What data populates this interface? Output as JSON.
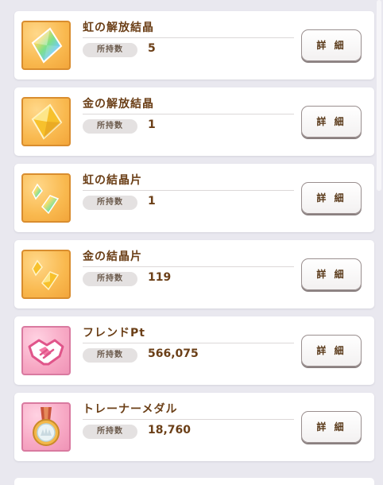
{
  "items": [
    {
      "name": "虹の解放結晶",
      "count_label": "所持数",
      "count": "5",
      "detail_label": "詳 細",
      "icon": "rainbow-crystal-icon",
      "theme": "gold"
    },
    {
      "name": "金の解放結晶",
      "count_label": "所持数",
      "count": "1",
      "detail_label": "詳 細",
      "icon": "gold-crystal-icon",
      "theme": "gold"
    },
    {
      "name": "虹の結晶片",
      "count_label": "所持数",
      "count": "1",
      "detail_label": "詳 細",
      "icon": "rainbow-shard-icon",
      "theme": "gold"
    },
    {
      "name": "金の結晶片",
      "count_label": "所持数",
      "count": "119",
      "detail_label": "詳 細",
      "icon": "gold-shard-icon",
      "theme": "gold"
    },
    {
      "name": "フレンドPt",
      "count_label": "所持数",
      "count": "566,075",
      "detail_label": "詳 細",
      "icon": "handshake-icon",
      "theme": "pink"
    },
    {
      "name": "トレーナーメダル",
      "count_label": "所持数",
      "count": "18,760",
      "detail_label": "詳 細",
      "icon": "medal-icon",
      "theme": "pink"
    }
  ],
  "colors": {
    "text_brown": "#6b3f17",
    "gold_bg": "#f9b94f",
    "pink_bg": "#f7a8c4",
    "page_bg": "#e9e8ef"
  }
}
